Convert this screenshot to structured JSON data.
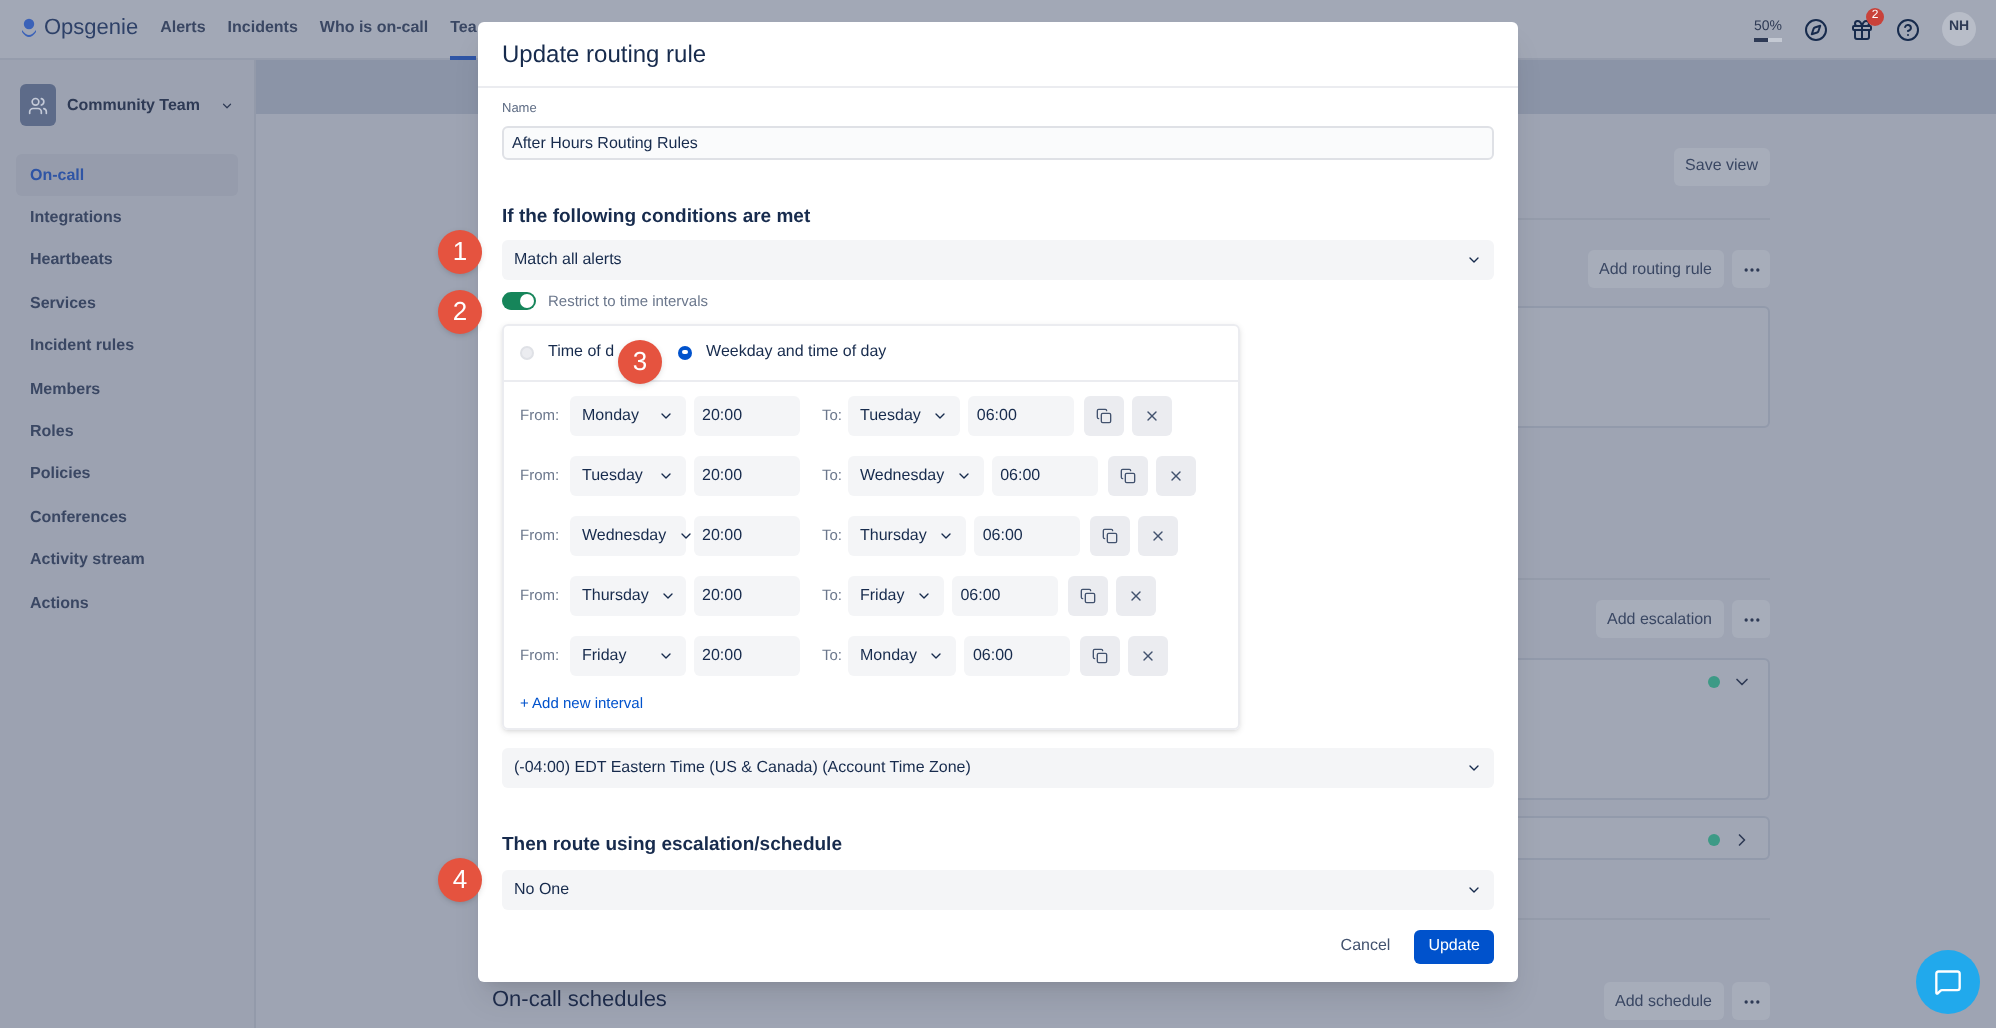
{
  "nav": {
    "logo": "Opsgenie",
    "items": [
      {
        "label": "Alerts",
        "selected": false
      },
      {
        "label": "Incidents",
        "selected": false
      },
      {
        "label": "Who is on-call",
        "selected": false
      },
      {
        "label": "Tea",
        "selected": true
      }
    ],
    "usage": {
      "reading": "50%",
      "level": 0.5
    },
    "notification_count": "2",
    "avatar": "NH"
  },
  "sidebar": {
    "team": "Community Team",
    "items": [
      {
        "label": "On-call",
        "selected": true
      },
      {
        "label": "Integrations",
        "selected": false
      },
      {
        "label": "Heartbeats",
        "selected": false
      },
      {
        "label": "Services",
        "selected": false
      },
      {
        "label": "Incident rules",
        "selected": false
      },
      {
        "label": "Members",
        "selected": false
      },
      {
        "label": "Roles",
        "selected": false
      },
      {
        "label": "Policies",
        "selected": false
      },
      {
        "label": "Conferences",
        "selected": false
      },
      {
        "label": "Activity stream",
        "selected": false
      },
      {
        "label": "Actions",
        "selected": false
      }
    ]
  },
  "main": {
    "save_view": "Save view",
    "add_routing_rule": "Add routing rule",
    "add_escalation": "Add escalation",
    "escalations": [
      {
        "expanded": true
      },
      {
        "expanded": false
      }
    ],
    "schedules_title": "On-call schedules",
    "add_schedule": "Add schedule"
  },
  "modal": {
    "title": "Update routing rule",
    "name_label": "Name",
    "name_value": "After Hours Routing Rules",
    "conditions_heading": "If the following conditions are met",
    "condition": "Match all alerts",
    "restrict": {
      "label": "Restrict to time intervals",
      "on": true
    },
    "interval_types": [
      {
        "label": "Time of d",
        "selected": false
      },
      {
        "label": "Weekday and time of day",
        "selected": true
      }
    ],
    "intervals": [
      {
        "from_label": "From:",
        "from_day": "Monday",
        "from_time": "20:00",
        "to_label": "To:",
        "to_day": "Tuesday",
        "to_time": "06:00"
      },
      {
        "from_label": "From:",
        "from_day": "Tuesday",
        "from_time": "20:00",
        "to_label": "To:",
        "to_day": "Wednesday",
        "to_time": "06:00"
      },
      {
        "from_label": "From:",
        "from_day": "Wednesday",
        "from_time": "20:00",
        "to_label": "To:",
        "to_day": "Thursday",
        "to_time": "06:00"
      },
      {
        "from_label": "From:",
        "from_day": "Thursday",
        "from_time": "20:00",
        "to_label": "To:",
        "to_day": "Friday",
        "to_time": "06:00"
      },
      {
        "from_label": "From:",
        "from_day": "Friday",
        "from_time": "20:00",
        "to_label": "To:",
        "to_day": "Monday",
        "to_time": "06:00"
      }
    ],
    "add_interval": "+ Add new interval",
    "timezone": "(-04:00) EDT Eastern Time (US & Canada) (Account Time Zone)",
    "route_heading": "Then route using escalation/schedule",
    "route_value": "No One",
    "cancel": "Cancel",
    "submit": "Update"
  },
  "callouts": [
    "1",
    "2",
    "3",
    "4"
  ]
}
